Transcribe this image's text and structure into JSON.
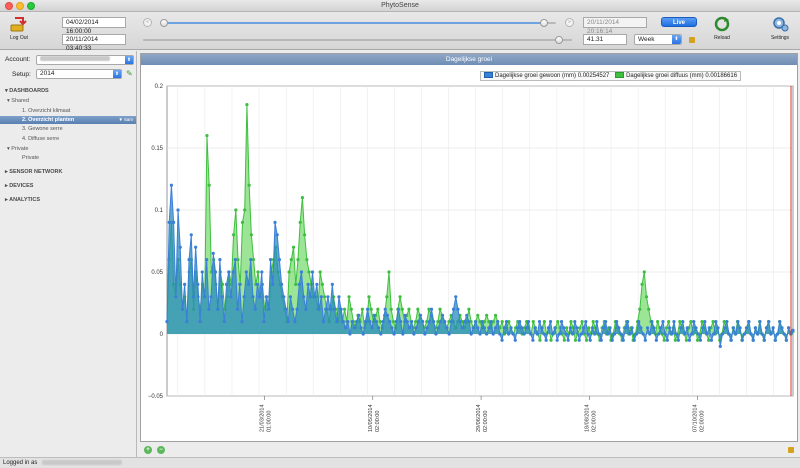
{
  "window": {
    "title": "PhytoSense"
  },
  "toolbar": {
    "logout_label": "Log Out",
    "start_date": "04/02/2014 16:00:00",
    "current_date": "20/11/2014 03:40:33",
    "end_date": "20/11/2014 20:16:14",
    "live_label": "Live",
    "zoom_value": "41.31",
    "period_select": "Week",
    "reload_label": "Reload",
    "settings_label": "Settings",
    "range_slider_level": 0.97,
    "position_slider_level": 0.97
  },
  "sidebar": {
    "account_label": "Account:",
    "account_value": "",
    "setup_label": "Setup:",
    "setup_value": "2014",
    "dashboards_header": "DASHBOARDS",
    "shared_label": "Shared",
    "items": [
      {
        "label": "1. Overzicht klimaat"
      },
      {
        "label": "2. Overzicht planten",
        "badge": "▼ 6am"
      },
      {
        "label": "3. Gewone serre"
      },
      {
        "label": "4. Diffuse serre"
      }
    ],
    "private_label": "Private",
    "private_item": "Private",
    "sensor_network_header": "SENSOR NETWORK",
    "devices_header": "DEVICES",
    "analytics_header": "ANALYTICS"
  },
  "chart": {
    "panel_title": "Dagelijkse groei",
    "legend_gewoon": "Dagelijkse groei gewoon (mm) 0.00254527",
    "legend_diffuus": "Dagelijkse groei diffuus (mm) 0.00186616"
  },
  "status": {
    "logged_in_text": "Logged in as"
  },
  "colors": {
    "gewoon": "#3b7fd8",
    "diffuus": "#3fbf3f",
    "cursor": "#e0302a"
  },
  "chart_data": {
    "type": "area",
    "title": "Dagelijkse groei",
    "xlabel": "",
    "ylabel": "",
    "ylim": [
      -0.05,
      0.2
    ],
    "yticks": [
      "0.2",
      "0.15",
      "0.1",
      "0.05",
      "0",
      "−0.05"
    ],
    "xticks": [
      {
        "date": "21/03/2014",
        "time": "01:00:00",
        "day": 45
      },
      {
        "date": "10/05/2014",
        "time": "02:00:00",
        "day": 95
      },
      {
        "date": "29/06/2014",
        "time": "02:00:00",
        "day": 145
      },
      {
        "date": "18/08/2014",
        "time": "02:00:00",
        "day": 195
      },
      {
        "date": "07/10/2014",
        "time": "02:00:00",
        "day": 245
      }
    ],
    "xlim": [
      0,
      289
    ],
    "grid": true,
    "legend_position": "top",
    "series": [
      {
        "name": "Dagelijkse groei gewoon (mm) 0.00254527",
        "values": [
          0.01,
          0.09,
          0.12,
          0.09,
          0.03,
          0.1,
          0.07,
          0.02,
          0.04,
          0.01,
          0.06,
          0.08,
          0.03,
          0.07,
          0.04,
          0.01,
          0.05,
          0.03,
          0.06,
          0.02,
          0.03,
          0.065,
          0.05,
          0.02,
          0.06,
          0.03,
          0.01,
          0.04,
          0.05,
          0.03,
          0.05,
          0.06,
          0.02,
          0.04,
          0.01,
          0.03,
          0.05,
          0.04,
          0.06,
          0.03,
          0.02,
          0.04,
          0.03,
          0.05,
          0.01,
          0.03,
          0.02,
          0.06,
          0.04,
          0.09,
          0.08,
          0.06,
          0.04,
          0.03,
          0.02,
          0.01,
          0.03,
          0.02,
          0.01,
          0.02,
          0.04,
          0.05,
          0.03,
          0.02,
          0.04,
          0.03,
          0.05,
          0.03,
          0.04,
          0.02,
          0.03,
          0.01,
          0.02,
          0.03,
          0.02,
          0.04,
          0.02,
          0.01,
          0.03,
          0.02,
          0.01,
          0.005,
          0.01,
          0.0,
          0.01,
          0.005,
          0.01,
          0.015,
          0.005,
          0.0,
          0.01,
          0.02,
          0.01,
          0.005,
          0.015,
          0.01,
          0.005,
          0.0,
          0.01,
          0.02,
          0.015,
          0.01,
          0.005,
          0.0,
          0.01,
          0.02,
          0.01,
          0.0,
          0.015,
          0.01,
          0.005,
          0.01,
          0.0,
          0.005,
          0.01,
          0.015,
          0.01,
          0.0,
          0.005,
          0.01,
          0.02,
          0.01,
          0.0,
          0.005,
          0.01,
          0.015,
          0.01,
          0.005,
          0.0,
          0.01,
          0.02,
          0.03,
          0.02,
          0.01,
          0.005,
          0.01,
          0.015,
          0.01,
          0.0,
          0.005,
          0.01,
          0.005,
          0.0,
          0.01,
          0.005,
          0.0,
          0.005,
          0.01,
          0.0,
          0.005,
          0.01,
          0.0,
          -0.005,
          0.005,
          0.01,
          0.0,
          0.005,
          0.0,
          -0.005,
          0.005,
          0.01,
          0.005,
          0.0,
          0.005,
          0.01,
          0.0,
          -0.005,
          0.005,
          0.0,
          0.01,
          0.005,
          0.0,
          -0.005,
          0.005,
          0.01,
          0.0,
          0.005,
          -0.005,
          0.0,
          0.01,
          0.005,
          0.0,
          -0.005,
          0.005,
          0.0,
          0.01,
          0.005,
          -0.005,
          0.0,
          0.005,
          0.01,
          0.0,
          -0.005,
          0.005,
          0.0,
          0.01,
          0.0,
          -0.005,
          0.005,
          0.01,
          0.0,
          0.005,
          -0.005,
          0.0,
          0.01,
          0.005,
          0.0,
          -0.005,
          0.005,
          0.01,
          0.0,
          0.005,
          -0.005,
          0.0,
          0.01,
          0.005,
          0.0,
          -0.005,
          0.005,
          0.0,
          0.01,
          0.005,
          -0.005,
          0.0,
          0.005,
          0.01,
          0.0,
          -0.005,
          0.005,
          0.0,
          0.01,
          0.0,
          -0.005,
          0.005,
          0.01,
          0.0,
          0.005,
          -0.005,
          0.0,
          0.01,
          0.005,
          0.0,
          -0.005,
          0.005,
          0.01,
          0.0,
          0.005,
          -0.005,
          0.0,
          0.01,
          0.005,
          -0.01,
          0.0,
          0.005,
          0.01,
          0.0,
          -0.005,
          0.005,
          0.0,
          0.01,
          0.005,
          -0.005,
          0.0,
          0.005,
          0.01,
          0.0,
          -0.005,
          0.005,
          0.0,
          0.01,
          0.0,
          -0.005,
          0.005,
          0.01,
          0.0,
          0.005,
          -0.005,
          0.0,
          0.01,
          0.005,
          0.0,
          -0.005,
          0.005,
          0.0,
          0.003
        ]
      },
      {
        "name": "Dagelijkse groei diffuus (mm) 0.00186616",
        "values": [
          0.01,
          0.06,
          0.09,
          0.04,
          0.03,
          0.06,
          0.04,
          0.02,
          0.03,
          0.01,
          0.05,
          0.06,
          0.02,
          0.05,
          0.03,
          0.02,
          0.04,
          0.03,
          0.16,
          0.12,
          0.05,
          0.06,
          0.04,
          0.02,
          0.05,
          0.04,
          0.02,
          0.03,
          0.05,
          0.04,
          0.08,
          0.1,
          0.06,
          0.04,
          0.09,
          0.1,
          0.185,
          0.12,
          0.08,
          0.06,
          0.04,
          0.05,
          0.03,
          0.04,
          0.02,
          0.03,
          0.02,
          0.05,
          0.06,
          0.07,
          0.05,
          0.04,
          0.03,
          0.02,
          0.01,
          0.05,
          0.06,
          0.07,
          0.04,
          0.06,
          0.09,
          0.11,
          0.08,
          0.06,
          0.05,
          0.04,
          0.03,
          0.03,
          0.02,
          0.05,
          0.04,
          0.03,
          0.02,
          0.01,
          0.02,
          0.03,
          0.02,
          0.01,
          0.02,
          0.01,
          0.02,
          0.01,
          0.03,
          0.02,
          0.01,
          0.005,
          0.015,
          0.01,
          0.02,
          0.005,
          0.01,
          0.03,
          0.02,
          0.01,
          0.015,
          0.02,
          0.01,
          0.005,
          0.015,
          0.03,
          0.05,
          0.02,
          0.01,
          0.005,
          0.02,
          0.03,
          0.02,
          0.01,
          0.015,
          0.02,
          0.01,
          0.005,
          0.01,
          0.02,
          0.015,
          0.01,
          0.005,
          0.01,
          0.02,
          0.015,
          0.01,
          0.005,
          0.01,
          0.02,
          0.015,
          0.01,
          0.005,
          0.01,
          0.015,
          0.01,
          0.005,
          0.01,
          0.015,
          0.01,
          0.005,
          0.01,
          0.02,
          0.01,
          0.005,
          0.01,
          0.015,
          0.01,
          0.005,
          0.01,
          0.015,
          0.01,
          0.005,
          0.01,
          0.015,
          0.01,
          0.005,
          0.01,
          0.0,
          0.005,
          0.01,
          0.005,
          0.0,
          0.005,
          0.01,
          0.005,
          0.0,
          0.005,
          0.01,
          0.005,
          0.0,
          0.01,
          0.005,
          0.0,
          -0.005,
          0.005,
          0.01,
          0.0,
          0.005,
          -0.005,
          0.0,
          0.005,
          0.01,
          0.005,
          0.0,
          -0.005,
          0.005,
          0.0,
          0.01,
          0.005,
          -0.005,
          0.0,
          0.005,
          0.01,
          0.0,
          -0.005,
          0.005,
          0.0,
          0.01,
          0.005,
          0.0,
          -0.005,
          0.005,
          0.01,
          0.0,
          0.005,
          -0.005,
          0.0,
          0.01,
          0.005,
          0.0,
          -0.005,
          0.005,
          0.01,
          0.0,
          0.005,
          -0.005,
          0.0,
          0.01,
          0.02,
          0.04,
          0.05,
          0.03,
          0.02,
          0.01,
          0.005,
          0.0,
          0.01,
          0.005,
          0.0,
          -0.005,
          0.005,
          0.01,
          0.0,
          0.005,
          -0.005,
          0.0,
          0.01,
          0.005,
          0.0,
          -0.005,
          0.005,
          0.01,
          0.0,
          0.005,
          -0.005,
          0.0,
          0.01,
          0.005,
          0.0,
          -0.005,
          0.005,
          0.01,
          0.0,
          0.005,
          -0.005,
          0.0,
          0.01,
          0.005,
          0.0,
          -0.005,
          0.005,
          0.0,
          0.01,
          0.005,
          -0.005,
          0.0,
          0.005,
          0.01,
          0.0,
          -0.005,
          0.005,
          0.0,
          0.01,
          0.0,
          -0.005,
          0.005,
          0.01,
          0.0,
          0.005,
          -0.005,
          0.0,
          0.01,
          0.005,
          0.0,
          -0.005,
          0.005,
          0.0,
          0.002
        ]
      }
    ]
  }
}
